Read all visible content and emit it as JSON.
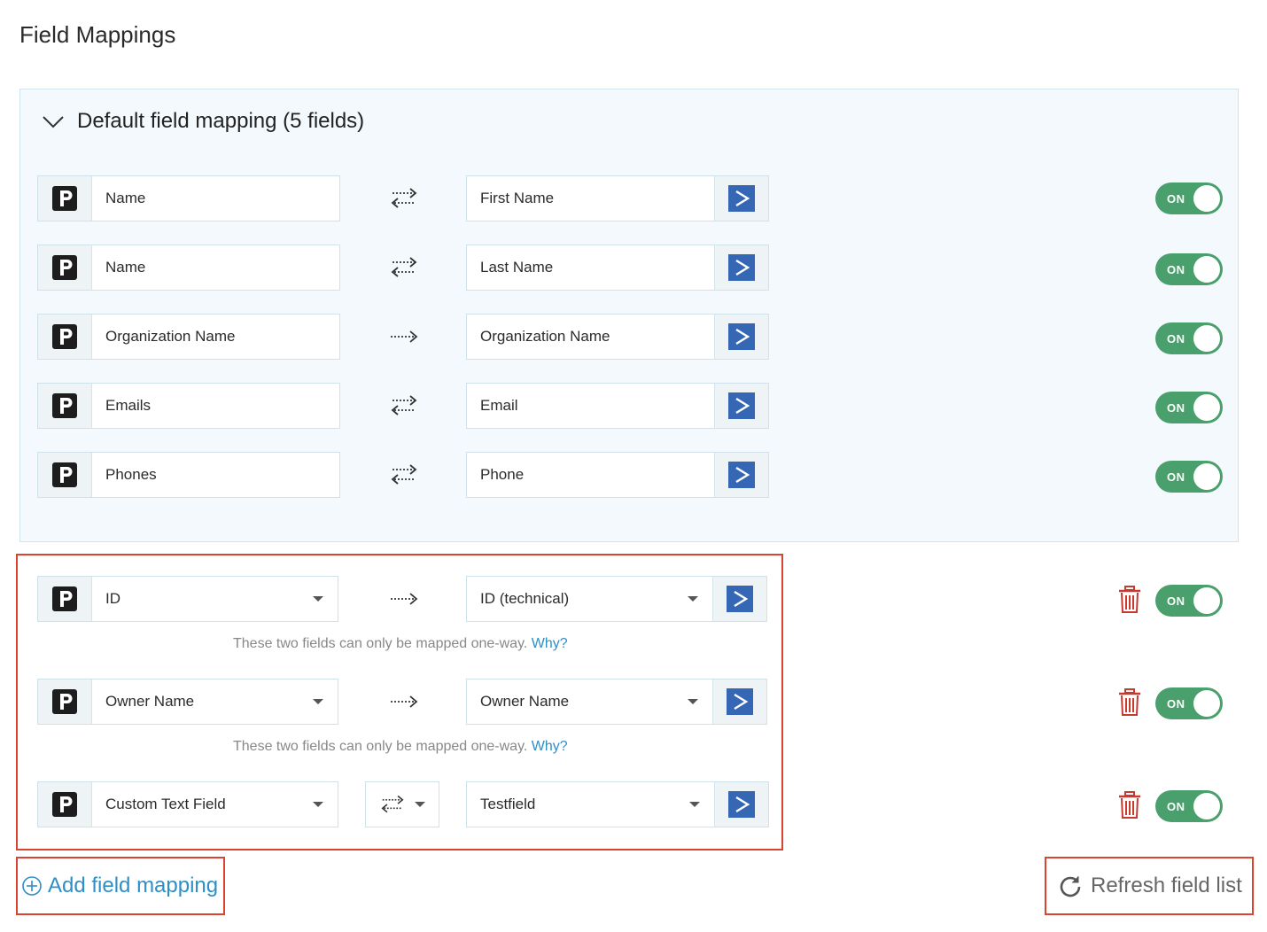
{
  "page": {
    "title": "Field Mappings"
  },
  "default_section": {
    "header": "Default field mapping (5 fields)",
    "rows": [
      {
        "source": "Name",
        "target": "First Name",
        "direction": "two-way",
        "toggle": "ON"
      },
      {
        "source": "Name",
        "target": "Last Name",
        "direction": "two-way",
        "toggle": "ON"
      },
      {
        "source": "Organization Name",
        "target": "Organization Name",
        "direction": "one-way",
        "toggle": "ON"
      },
      {
        "source": "Emails",
        "target": "Email",
        "direction": "two-way",
        "toggle": "ON"
      },
      {
        "source": "Phones",
        "target": "Phone",
        "direction": "two-way",
        "toggle": "ON"
      }
    ]
  },
  "custom_section": {
    "rows": [
      {
        "source": "ID",
        "target": "ID (technical)",
        "direction": "one-way",
        "toggle": "ON"
      },
      {
        "source": "Owner Name",
        "target": "Owner Name",
        "direction": "one-way",
        "toggle": "ON"
      },
      {
        "source": "Custom Text Field",
        "target": "Testfield",
        "direction": "two-way",
        "toggle": "ON"
      }
    ],
    "hint_text": "These two fields can only be mapped one-way.",
    "hint_link": "Why?"
  },
  "actions": {
    "add_label": "Add field mapping",
    "refresh_label": "Refresh field list"
  },
  "colors": {
    "toggle_on": "#4aa06c",
    "link": "#2d8fc7",
    "highlight_border": "#d9432f",
    "trash": "#c9392d",
    "target_logo": "#3567b5"
  },
  "icons": {
    "source_logo": "pipedrive-logo-icon",
    "target_logo": "activecampaign-logo-icon",
    "two_way": "two-way-arrows-icon",
    "one_way": "one-way-arrow-icon",
    "delete": "trash-icon",
    "add": "plus-circle-icon",
    "refresh": "refresh-icon",
    "collapse": "chevron-down-icon"
  }
}
